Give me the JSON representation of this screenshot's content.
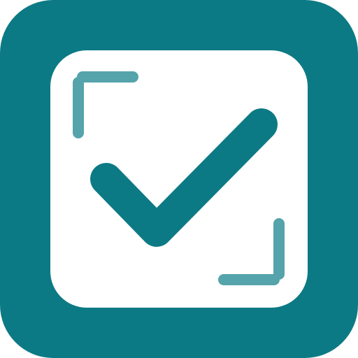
{
  "icon": {
    "name": "checkbox-scan-icon",
    "colors": {
      "tile": "#0c7a84",
      "card": "#ffffff",
      "check": "#0c7a84",
      "corners": "#55a3ab"
    }
  }
}
